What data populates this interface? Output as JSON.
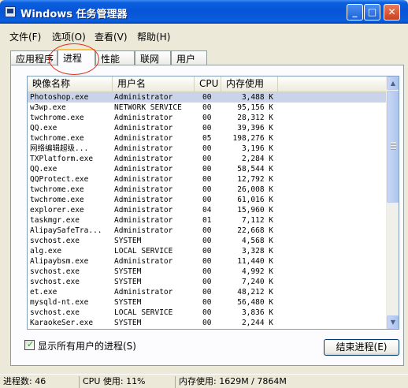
{
  "window": {
    "title": "Windows 任务管理器",
    "buttons": {
      "minimize": "_",
      "maximize": "□",
      "close": "✕"
    }
  },
  "menu": [
    "文件(F)",
    "选项(O)",
    "查看(V)",
    "帮助(H)"
  ],
  "tabs": [
    "应用程序",
    "进程",
    "性能",
    "联网",
    "用户"
  ],
  "active_tab": "进程",
  "columns": [
    "映像名称",
    "用户名",
    "CPU",
    "内存使用"
  ],
  "processes": [
    {
      "name": "Photoshop.exe",
      "user": "Administrator",
      "cpu": "00",
      "mem": "3,488 K"
    },
    {
      "name": "w3wp.exe",
      "user": "NETWORK SERVICE",
      "cpu": "00",
      "mem": "95,156 K"
    },
    {
      "name": "twchrome.exe",
      "user": "Administrator",
      "cpu": "00",
      "mem": "28,312 K"
    },
    {
      "name": "QQ.exe",
      "user": "Administrator",
      "cpu": "00",
      "mem": "39,396 K"
    },
    {
      "name": "twchrome.exe",
      "user": "Administrator",
      "cpu": "05",
      "mem": "198,276 K"
    },
    {
      "name": "网络编辑超级...",
      "user": "Administrator",
      "cpu": "00",
      "mem": "3,196 K"
    },
    {
      "name": "TXPlatform.exe",
      "user": "Administrator",
      "cpu": "00",
      "mem": "2,284 K"
    },
    {
      "name": "QQ.exe",
      "user": "Administrator",
      "cpu": "00",
      "mem": "58,544 K"
    },
    {
      "name": "QQProtect.exe",
      "user": "Administrator",
      "cpu": "00",
      "mem": "12,792 K"
    },
    {
      "name": "twchrome.exe",
      "user": "Administrator",
      "cpu": "00",
      "mem": "26,008 K"
    },
    {
      "name": "twchrome.exe",
      "user": "Administrator",
      "cpu": "00",
      "mem": "61,016 K"
    },
    {
      "name": "explorer.exe",
      "user": "Administrator",
      "cpu": "04",
      "mem": "15,960 K"
    },
    {
      "name": "taskmgr.exe",
      "user": "Administrator",
      "cpu": "01",
      "mem": "7,112 K"
    },
    {
      "name": "AlipaySafeTra...",
      "user": "Administrator",
      "cpu": "00",
      "mem": "22,668 K"
    },
    {
      "name": "svchost.exe",
      "user": "SYSTEM",
      "cpu": "00",
      "mem": "4,568 K"
    },
    {
      "name": "alg.exe",
      "user": "LOCAL SERVICE",
      "cpu": "00",
      "mem": "3,328 K"
    },
    {
      "name": "Alipaybsm.exe",
      "user": "Administrator",
      "cpu": "00",
      "mem": "11,440 K"
    },
    {
      "name": "svchost.exe",
      "user": "SYSTEM",
      "cpu": "00",
      "mem": "4,992 K"
    },
    {
      "name": "svchost.exe",
      "user": "SYSTEM",
      "cpu": "00",
      "mem": "7,240 K"
    },
    {
      "name": "et.exe",
      "user": "Administrator",
      "cpu": "00",
      "mem": "48,212 K"
    },
    {
      "name": "mysqld-nt.exe",
      "user": "SYSTEM",
      "cpu": "00",
      "mem": "56,480 K"
    },
    {
      "name": "svchost.exe",
      "user": "LOCAL SERVICE",
      "cpu": "00",
      "mem": "3,836 K"
    },
    {
      "name": "KaraokeSer.exe",
      "user": "SYSTEM",
      "cpu": "00",
      "mem": "2,244 K"
    }
  ],
  "selected_index": 0,
  "show_all_users": {
    "label": "显示所有用户的进程(S)",
    "checked": true
  },
  "end_process_button": "结束进程(E)",
  "status": {
    "processes": "进程数: 46",
    "cpu": "CPU 使用: 11%",
    "memory": "内存使用: 1629M / 7864M"
  }
}
